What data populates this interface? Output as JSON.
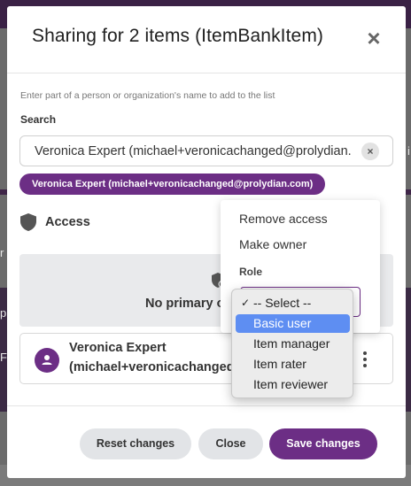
{
  "background": {
    "frag_left_1": "r",
    "frag_left_2": "p",
    "frag_left_3": "F",
    "frag_right_1": "i"
  },
  "modal": {
    "title": "Sharing for 2 items (ItemBankItem)",
    "close_symbol": "×",
    "hint": "Enter part of a person or organization's name to add to the list",
    "search_label": "Search",
    "search_value": "Veronica Expert (michael+veronicachanged@prolydian.",
    "clear_symbol": "×",
    "selected_chip": "Veronica Expert (michael+veronicachanged@prolydian.com)",
    "access_label": "Access",
    "no_primary_text": "No primary ow",
    "user": {
      "name": "Veronica Expert",
      "email": "(michael+veronicachanged@"
    },
    "buttons": {
      "reset": "Reset changes",
      "close": "Close",
      "save": "Save changes"
    }
  },
  "menu": {
    "remove_access": "Remove access",
    "make_owner": "Make owner",
    "role_label": "Role"
  },
  "role_dropdown": {
    "options": [
      "-- Select --",
      "Basic user",
      "Item manager",
      "Item rater",
      "Item reviewer"
    ],
    "checked_option": "-- Select --",
    "highlighted_option": "Basic user",
    "check_symbol": "✓"
  },
  "colors": {
    "brand_purple": "#6c2e85",
    "highlight_blue": "#5e8ef2"
  }
}
